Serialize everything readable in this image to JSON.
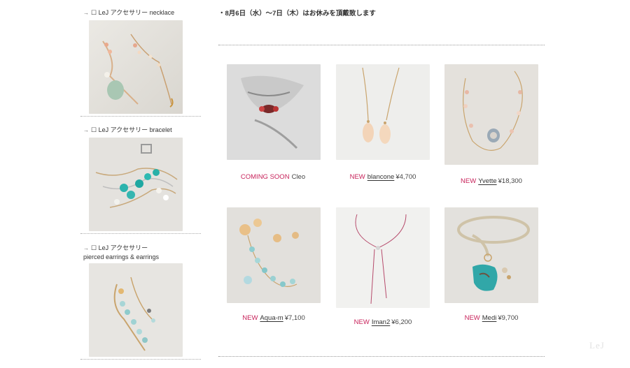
{
  "sidebar": {
    "categories": [
      {
        "arrow": "→",
        "label_line1": "☐ LeJ アクセサリー necklace",
        "label_line2": ""
      },
      {
        "arrow": "→",
        "label_line1": "☐ LeJ アクセサリー bracelet",
        "label_line2": ""
      },
      {
        "arrow": "→",
        "label_line1": "☐ LeJ アクセサリー",
        "label_line2": "pierced earrings & earrings"
      }
    ]
  },
  "notice": "・8月6日（水）〜7日（木）はお休みを頂戴致します",
  "products": [
    {
      "badge": "COMING SOON",
      "name": "Cleo",
      "price": ""
    },
    {
      "badge": "NEW",
      "name": "blancone",
      "price": "¥4,700"
    },
    {
      "badge": "NEW",
      "name": "Yvette",
      "price": "¥18,300"
    },
    {
      "badge": "NEW",
      "name": "Aqua-m",
      "price": "¥7,100"
    },
    {
      "badge": "NEW",
      "name": "Iman2",
      "price": "¥6,200"
    },
    {
      "badge": "NEW",
      "name": "Medi",
      "price": "¥9,700"
    }
  ],
  "logo": "LeJ",
  "colors": {
    "accent": "#c8235b",
    "text": "#333333",
    "rule": "#999999"
  }
}
